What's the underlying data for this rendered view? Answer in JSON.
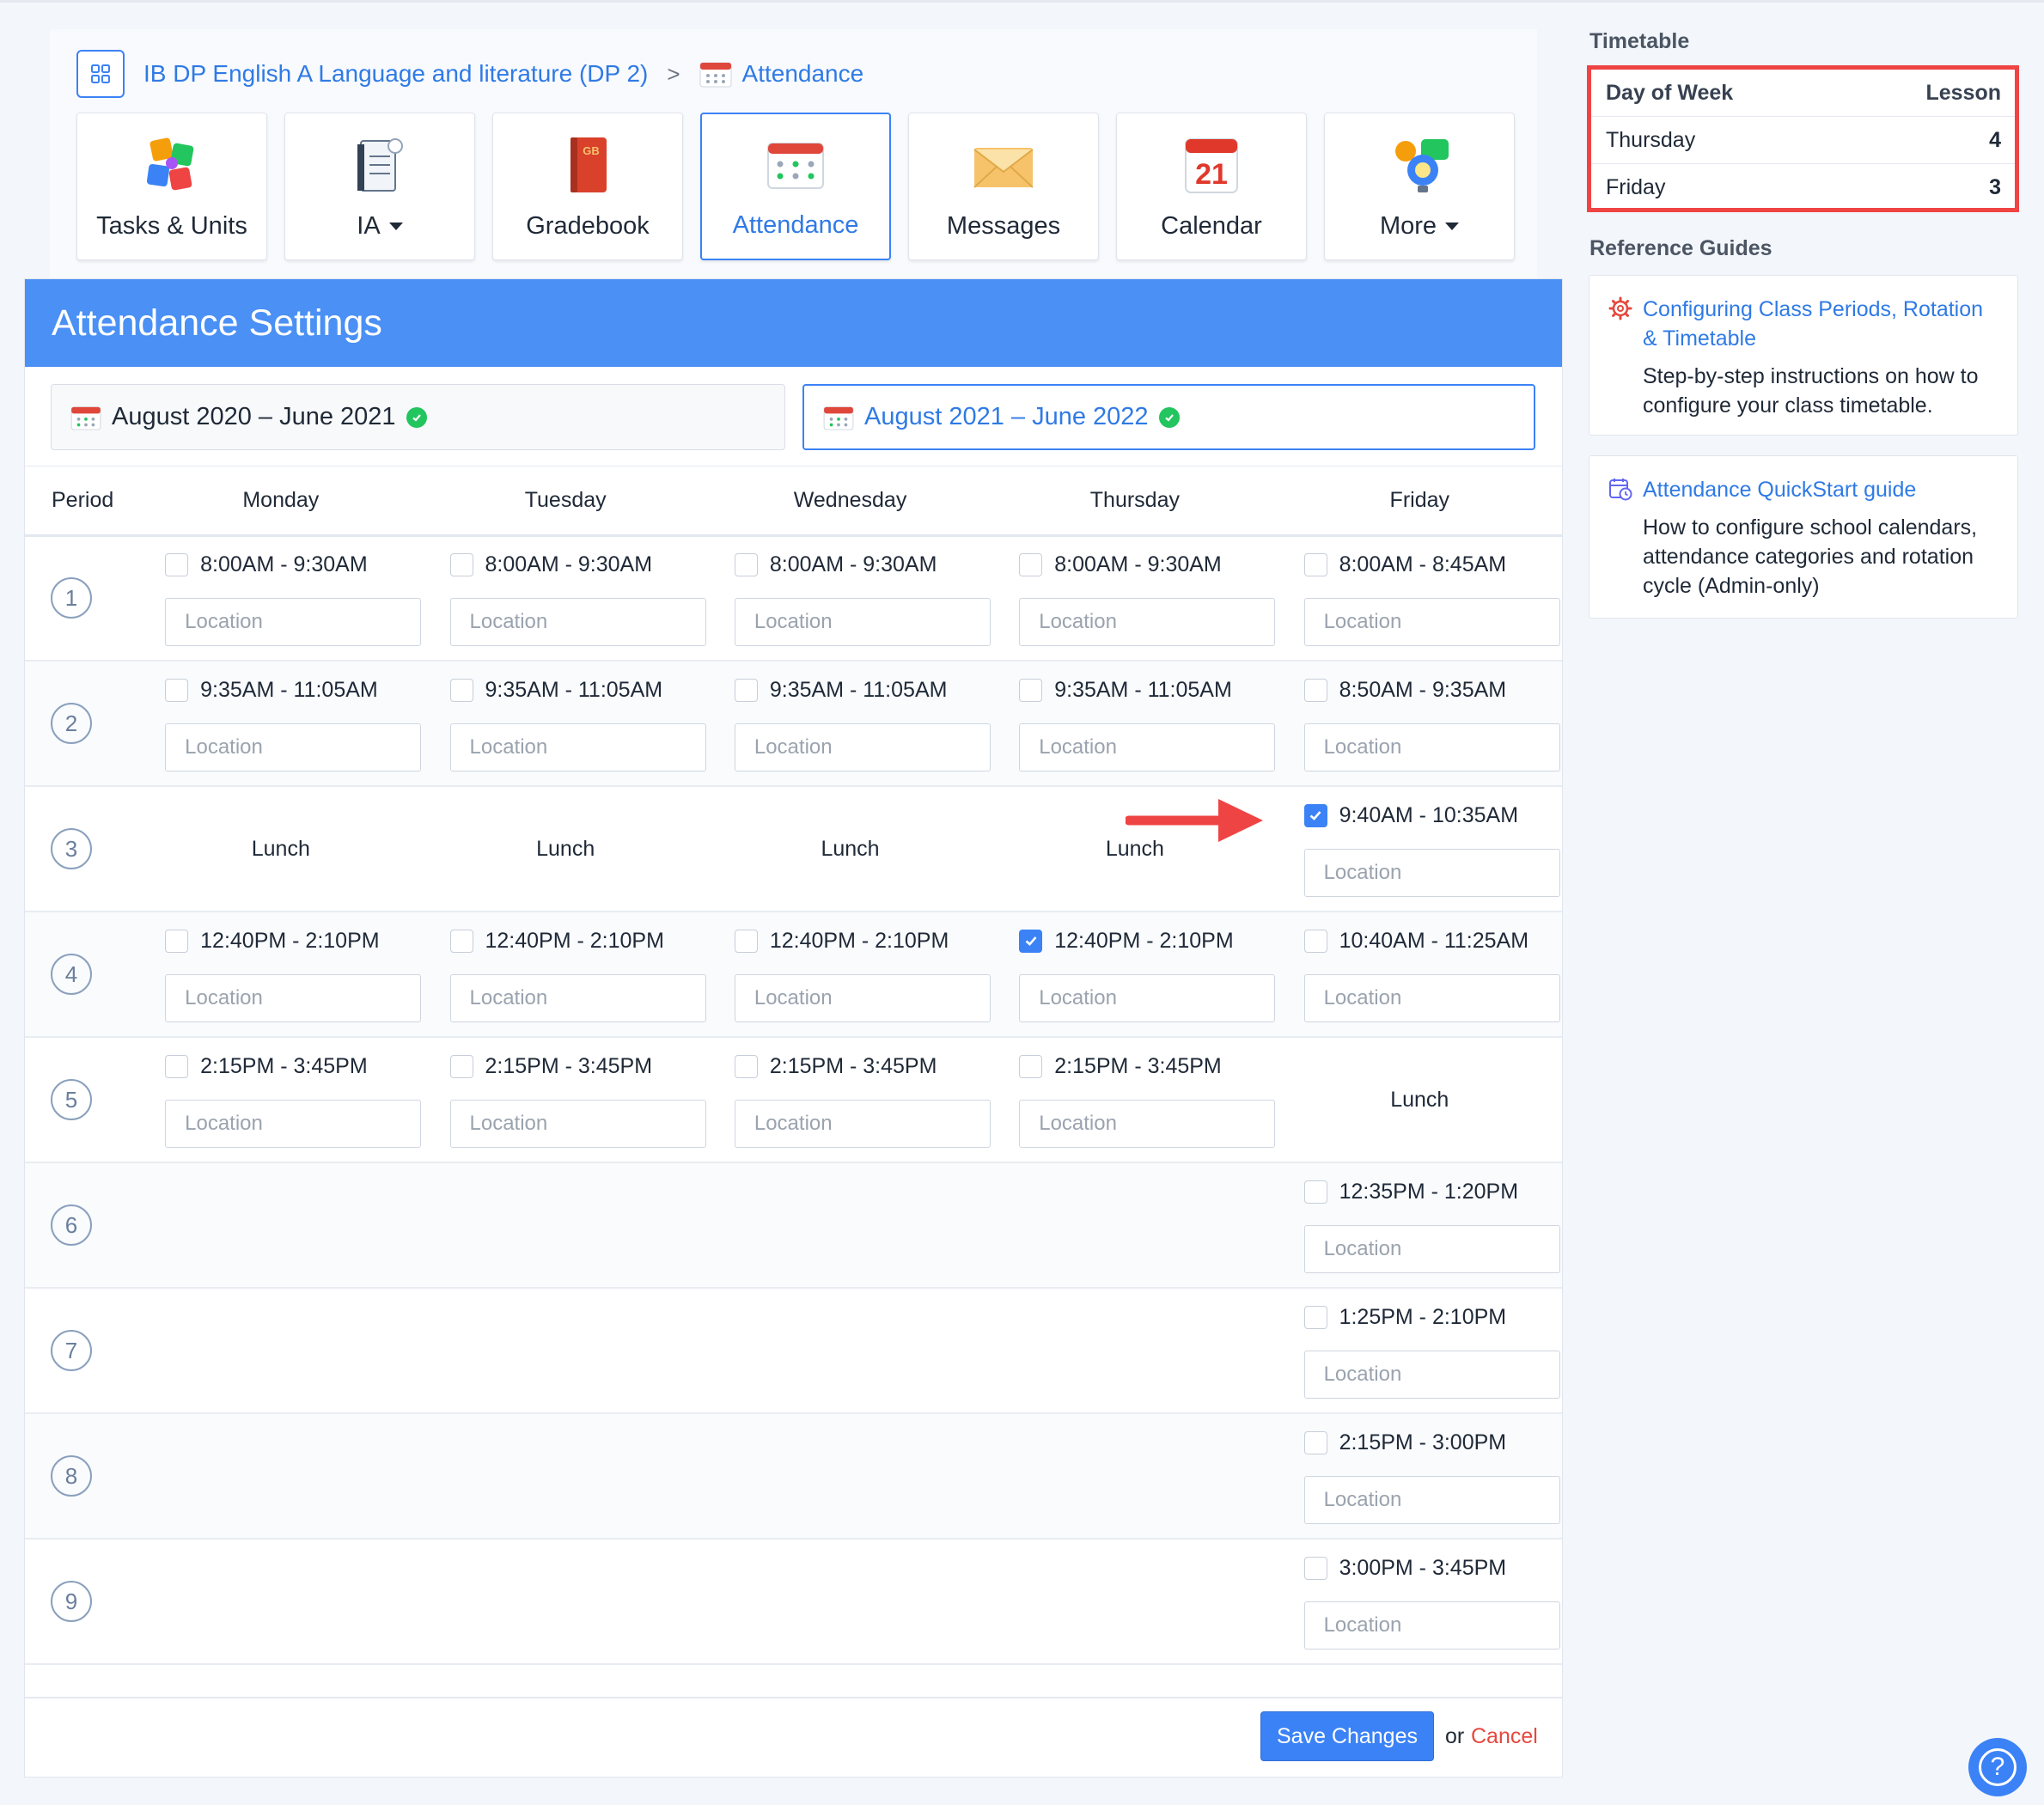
{
  "breadcrumb": {
    "course": "IB DP English A Language and literature (DP 2)",
    "separator": ">",
    "current": "Attendance"
  },
  "nav_tiles": [
    {
      "label": "Tasks & Units",
      "icon": "puzzle-icon",
      "dropdown": false
    },
    {
      "label": "IA",
      "icon": "ia-notebook-icon",
      "dropdown": true
    },
    {
      "label": "Gradebook",
      "icon": "gradebook-book-icon",
      "dropdown": false
    },
    {
      "label": "Attendance",
      "icon": "attendance-calendar-icon",
      "dropdown": false,
      "active": true
    },
    {
      "label": "Messages",
      "icon": "envelope-icon",
      "dropdown": false
    },
    {
      "label": "Calendar",
      "icon": "calendar-21-icon",
      "dropdown": false
    },
    {
      "label": "More",
      "icon": "lightbulb-chat-icon",
      "dropdown": true
    }
  ],
  "tile_icon_text": {
    "gradebook": "GB",
    "calendar_day": "21"
  },
  "page_title": "Attendance Settings",
  "years": [
    {
      "label": "August 2020 – June 2021",
      "selected": false
    },
    {
      "label": "August 2021 – June 2022",
      "selected": true
    }
  ],
  "table": {
    "period_header": "Period",
    "days": [
      "Monday",
      "Tuesday",
      "Wednesday",
      "Thursday",
      "Friday"
    ],
    "location_placeholder": "Location",
    "lunch_label": "Lunch",
    "periods": [
      {
        "num": "1",
        "slots": [
          {
            "time": "8:00AM - 9:30AM",
            "checked": false
          },
          {
            "time": "8:00AM - 9:30AM",
            "checked": false
          },
          {
            "time": "8:00AM - 9:30AM",
            "checked": false
          },
          {
            "time": "8:00AM - 9:30AM",
            "checked": false
          },
          {
            "time": "8:00AM - 8:45AM",
            "checked": false
          }
        ]
      },
      {
        "num": "2",
        "slots": [
          {
            "time": "9:35AM - 11:05AM",
            "checked": false
          },
          {
            "time": "9:35AM - 11:05AM",
            "checked": false
          },
          {
            "time": "9:35AM - 11:05AM",
            "checked": false
          },
          {
            "time": "9:35AM - 11:05AM",
            "checked": false
          },
          {
            "time": "8:50AM - 9:35AM",
            "checked": false
          }
        ]
      },
      {
        "num": "3",
        "slots": [
          {
            "lunch": true
          },
          {
            "lunch": true
          },
          {
            "lunch": true
          },
          {
            "lunch": true
          },
          {
            "time": "9:40AM - 10:35AM",
            "checked": true
          }
        ]
      },
      {
        "num": "4",
        "slots": [
          {
            "time": "12:40PM - 2:10PM",
            "checked": false
          },
          {
            "time": "12:40PM - 2:10PM",
            "checked": false
          },
          {
            "time": "12:40PM - 2:10PM",
            "checked": false
          },
          {
            "time": "12:40PM - 2:10PM",
            "checked": true
          },
          {
            "time": "10:40AM - 11:25AM",
            "checked": false
          }
        ]
      },
      {
        "num": "5",
        "slots": [
          {
            "time": "2:15PM - 3:45PM",
            "checked": false
          },
          {
            "time": "2:15PM - 3:45PM",
            "checked": false
          },
          {
            "time": "2:15PM - 3:45PM",
            "checked": false
          },
          {
            "time": "2:15PM - 3:45PM",
            "checked": false
          },
          {
            "lunch": true
          }
        ]
      },
      {
        "num": "6",
        "slots": [
          {},
          {},
          {},
          {},
          {
            "time": "12:35PM - 1:20PM",
            "checked": false
          }
        ]
      },
      {
        "num": "7",
        "slots": [
          {},
          {},
          {},
          {},
          {
            "time": "1:25PM - 2:10PM",
            "checked": false
          }
        ]
      },
      {
        "num": "8",
        "slots": [
          {},
          {},
          {},
          {},
          {
            "time": "2:15PM - 3:00PM",
            "checked": false
          }
        ]
      },
      {
        "num": "9",
        "slots": [
          {},
          {},
          {},
          {},
          {
            "time": "3:00PM - 3:45PM",
            "checked": false
          }
        ]
      }
    ]
  },
  "footer": {
    "save_label": "Save Changes",
    "or_text": "or",
    "cancel_label": "Cancel"
  },
  "sidebar": {
    "timetable_heading": "Timetable",
    "timetable": {
      "col1": "Day of Week",
      "col2": "Lesson",
      "rows": [
        {
          "day": "Thursday",
          "lesson": "4"
        },
        {
          "day": "Friday",
          "lesson": "3"
        }
      ]
    },
    "guides_heading": "Reference Guides",
    "guides": [
      {
        "title": "Configuring Class Periods, Rotation & Timetable",
        "desc": "Step-by-step instructions on how to configure your class timetable.",
        "icon": "gear-icon"
      },
      {
        "title": "Attendance QuickStart guide",
        "desc": "How to configure school calendars, attendance categories and rotation cycle (Admin-only)",
        "icon": "calendar-clock-icon"
      }
    ]
  },
  "colors": {
    "accent": "#3b82f6",
    "title_bar": "#4a90f5",
    "highlight_box": "#ef4444",
    "cancel": "#e5483d",
    "success": "#22c55e"
  }
}
